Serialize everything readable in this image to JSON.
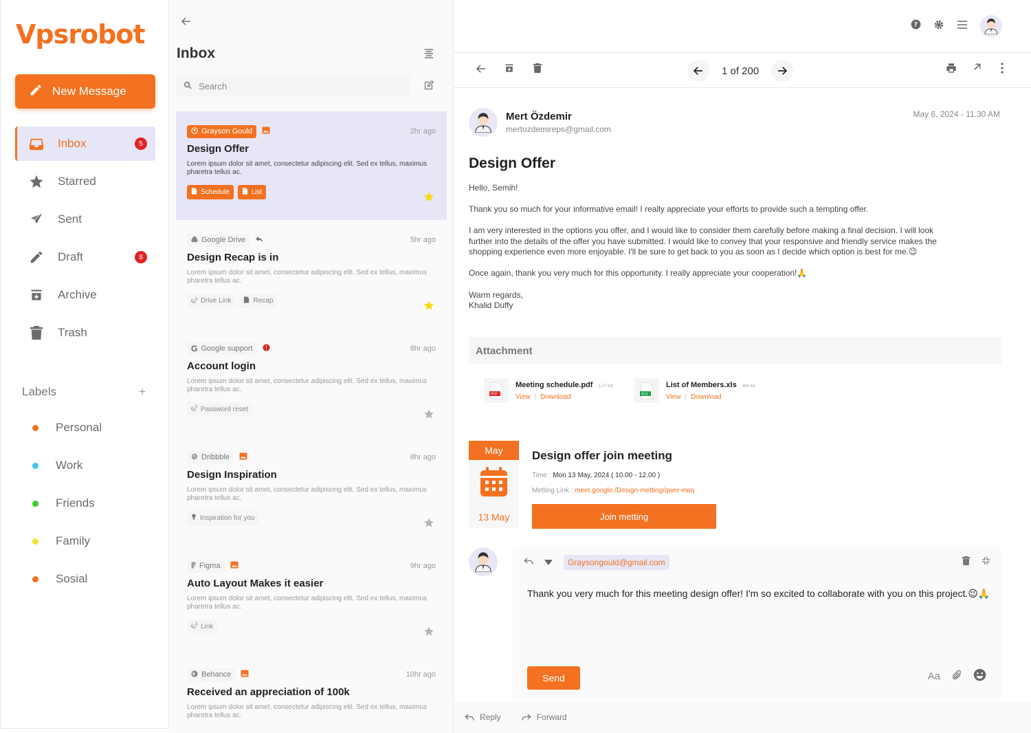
{
  "brand": {
    "logo": "Vpsrobot",
    "accent": "#f37120"
  },
  "sidebar": {
    "new_message": "New Message",
    "items": [
      {
        "label": "Inbox",
        "icon": "inbox-icon",
        "badge": "5"
      },
      {
        "label": "Starred",
        "icon": "star-icon"
      },
      {
        "label": "Sent",
        "icon": "send-icon"
      },
      {
        "label": "Draft",
        "icon": "pencil-icon",
        "badge": "8"
      },
      {
        "label": "Archive",
        "icon": "archive-icon"
      },
      {
        "label": "Trash",
        "icon": "trash-icon"
      }
    ],
    "labels_title": "Labels",
    "labels_add": "+",
    "labels": [
      {
        "label": "Personal",
        "color": "#f37120"
      },
      {
        "label": "Work",
        "color": "#3ec8f0"
      },
      {
        "label": "Friends",
        "color": "#3ccf2c"
      },
      {
        "label": "Family",
        "color": "#f2e234"
      },
      {
        "label": "Sosial",
        "color": "#f37120"
      }
    ]
  },
  "list": {
    "title": "Inbox",
    "search_placeholder": "Search",
    "mails": [
      {
        "sender": "Grayson Gould",
        "time": "2hr ago",
        "subject": "Design Offer",
        "body": "Lorem ipsum dolor sit amet, consectetur adipiscing elit. Sed ex tellus, maximus pharetra tellus ac.",
        "tags": [
          "Schedule",
          "List"
        ]
      },
      {
        "sender": "Google Drive",
        "time": "5hr ago",
        "subject": "Design Recap is in",
        "body": "Lorem ipsum dolor sit amet, consectetur adipiscing elit. Sed ex tellus, maximus pharetra tellus ac.",
        "tags": [
          "Drive Link",
          "Recap"
        ]
      },
      {
        "sender": "Google support",
        "time": "8hr ago",
        "subject": "Account login",
        "body": "Lorem ipsum dolor sit amet, consectetur adipiscing elit. Sed ex tellus, maximus pharetra tellus ac.",
        "tags": [
          "Password reset"
        ]
      },
      {
        "sender": "Dribbble",
        "time": "8hr ago",
        "subject": "Design Inspiration",
        "body": "Lorem ipsum dolor sit amet, consectetur adipiscing elit. Sed ex tellus, maximus pharetra tellus ac.",
        "tags": [
          "Inspiration for you"
        ]
      },
      {
        "sender": "Figma",
        "time": "9hr ago",
        "subject": "Auto Layout Makes it easier",
        "body": "Lorem ipsum dolor sit amet, consectetur adipiscing elit. Sed ex tellus, maximus pharetra tellus ac.",
        "tags": [
          "Link"
        ]
      },
      {
        "sender": "Behance",
        "time": "10hr ago",
        "subject": "Received an appreciation of 100k",
        "body": "Lorem ipsum dolor sit amet, consectetur adipiscing elit. Sed ex tellus, maximus pharetra tellus ac.",
        "tags": []
      }
    ]
  },
  "detail": {
    "pager": "1 of 200",
    "from_name": "Mert Özdemir",
    "from_email": "mertozdemireps@gmail.com",
    "date": "May 6, 2024 - 11.30 AM",
    "subject": "Design Offer",
    "paragraphs": [
      "Hello, Semih!",
      "Thank you so much for your informative email! I really appreciate your efforts to provide such a tempting offer.",
      "I am very interested in the options you offer, and I would like to consider them carefully before making a final decision. I will look further into the details of the offer you have submitted. I would like to convey that your responsive and friendly service makes the shopping experience even more enjoyable. I'll be sure to get back to you as soon as I decide which option is best for me.😉",
      "Once again, thank you very much for this opportunity. I really appreciate your cooperation!🙏"
    ],
    "sign_1": "Warm regards,",
    "sign_2": "Khalid Duffy",
    "attachment_title": "Attachment",
    "files": [
      {
        "name": "Meeting schedule.pdf",
        "size": "1.27 Mb",
        "type": "PDF",
        "view": "View",
        "download": "Download"
      },
      {
        "name": "List of Members.xls",
        "size": "563 Kb",
        "type": "XLS",
        "view": "View",
        "download": "Download"
      }
    ],
    "meeting": {
      "month": "May",
      "date": "13 May",
      "title": "Design offer join meeting",
      "time_label": "Time : ",
      "time_value": "Mon 13 May, 2024 ( 10.00 - 12.00 )",
      "link_label": "Metting Link : ",
      "link_value": "meet.google./Design-metting/qwer-ewq",
      "join": "Join metting"
    },
    "reply": {
      "to": "Graysongould@gmail.com",
      "text": "Thank you very much for this meeting design offer! I'm so excited to collaborate with you on this project.😉🙏",
      "send": "Send",
      "font_tool": "Aa"
    },
    "footer": {
      "reply": "Reply",
      "forward": "Forward"
    }
  }
}
